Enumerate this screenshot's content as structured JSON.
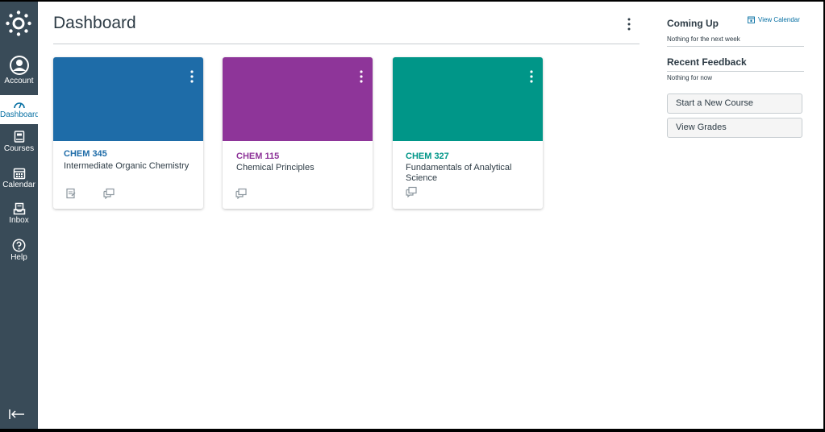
{
  "nav": {
    "account": "Account",
    "dashboard": "Dashboard",
    "courses": "Courses",
    "calendar": "Calendar",
    "inbox": "Inbox",
    "help": "Help"
  },
  "main": {
    "title": "Dashboard"
  },
  "cards": [
    {
      "code": "CHEM 345",
      "name": "Intermediate Organic Chemistry",
      "color": "#1e6ca8"
    },
    {
      "code": "CHEM 115",
      "name": "Chemical Principles",
      "color": "#8e3599"
    },
    {
      "code": "CHEM 327",
      "name": "Fundamentals of Analytical Science",
      "color": "#009688"
    }
  ],
  "sidebar": {
    "coming_up": "Coming Up",
    "view_calendar": "View Calendar",
    "coming_up_empty": "Nothing for the next week",
    "recent_feedback": "Recent Feedback",
    "feedback_empty": "Nothing for now",
    "start_course": "Start a New Course",
    "view_grades": "View Grades"
  }
}
